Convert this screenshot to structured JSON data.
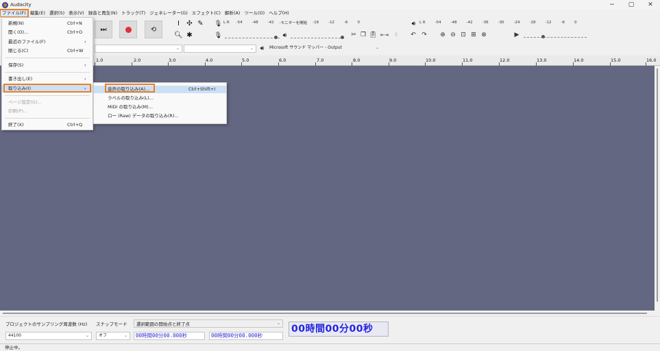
{
  "window": {
    "title": "Audacity",
    "controls": {
      "minimize": "−",
      "maximize": "▢",
      "close": "✕"
    }
  },
  "menubar": [
    "ファイル(F)",
    "編集(E)",
    "選択(S)",
    "表示(V)",
    "録音と再生(N)",
    "トラック(T)",
    "ジェネレーター(G)",
    "エフェクト(C)",
    "解析(A)",
    "ツール(O)",
    "ヘルプ(H)"
  ],
  "meters": {
    "record_scale": [
      "-54",
      "-48",
      "-42",
      "-モニターを開始",
      "-18",
      "-12",
      "-6",
      "0"
    ],
    "record_monitor_text": "モニターを開始",
    "play_scale": [
      "-54",
      "-48",
      "-42",
      "-36",
      "-30",
      "-24",
      "-18",
      "-12",
      "-6",
      "0"
    ],
    "lr": "L\nR"
  },
  "devices": {
    "output": "Microsoft サウンド マッパー - Output"
  },
  "ruler": [
    "1.0",
    "2.0",
    "3.0",
    "4.0",
    "5.0",
    "6.0",
    "7.0",
    "8.0",
    "9.0",
    "10.0",
    "11.0",
    "12.0",
    "13.0",
    "14.0",
    "15.0",
    "16.0"
  ],
  "file_menu": {
    "items": [
      {
        "label": "新規(N)",
        "shortcut": "Ctrl+N",
        "disabled": false,
        "submenu": false
      },
      {
        "label": "開く(O)...",
        "shortcut": "Ctrl+O",
        "disabled": false,
        "submenu": false
      },
      {
        "label": "最近のファイル(F)",
        "shortcut": "",
        "disabled": false,
        "submenu": true
      },
      {
        "label": "閉じる(C)",
        "shortcut": "Ctrl+W",
        "disabled": false,
        "submenu": false
      },
      {
        "label": "保存(S)",
        "shortcut": "",
        "disabled": false,
        "submenu": true
      },
      {
        "label": "書き出し(E)",
        "shortcut": "",
        "disabled": false,
        "submenu": true
      },
      {
        "label": "取り込み(I)",
        "shortcut": "",
        "disabled": false,
        "submenu": true,
        "highlight": true
      },
      {
        "label": "ページ設定(G)...",
        "shortcut": "",
        "disabled": true,
        "submenu": false
      },
      {
        "label": "印刷(P)...",
        "shortcut": "",
        "disabled": true,
        "submenu": false
      },
      {
        "label": "終了(X)",
        "shortcut": "Ctrl+Q",
        "disabled": false,
        "submenu": false
      }
    ]
  },
  "import_menu": {
    "items": [
      {
        "label": "音声の取り込み(A)...",
        "shortcut": "Ctrl+Shift+I"
      },
      {
        "label": "ラベルの取り込み(L)...",
        "shortcut": ""
      },
      {
        "label": "MIDI の取り込み(M)...",
        "shortcut": ""
      },
      {
        "label": "ロー (Raw) データの取り込み(R)...",
        "shortcut": ""
      }
    ]
  },
  "selection_toolbar": {
    "rate_label": "プロジェクトのサンプリング周波数 (Hz)",
    "rate_value": "44100",
    "snap_label": "スナップモード",
    "snap_value": "オフ",
    "sel_label": "選択範囲の開始点と終了点",
    "start_time": "00時間00分00.000秒",
    "end_time": "00時間00分00.000秒",
    "audio_position": "00時間00分00秒"
  },
  "status": "停止中。",
  "accent": "#ef7d22",
  "track_bg": "#646781"
}
